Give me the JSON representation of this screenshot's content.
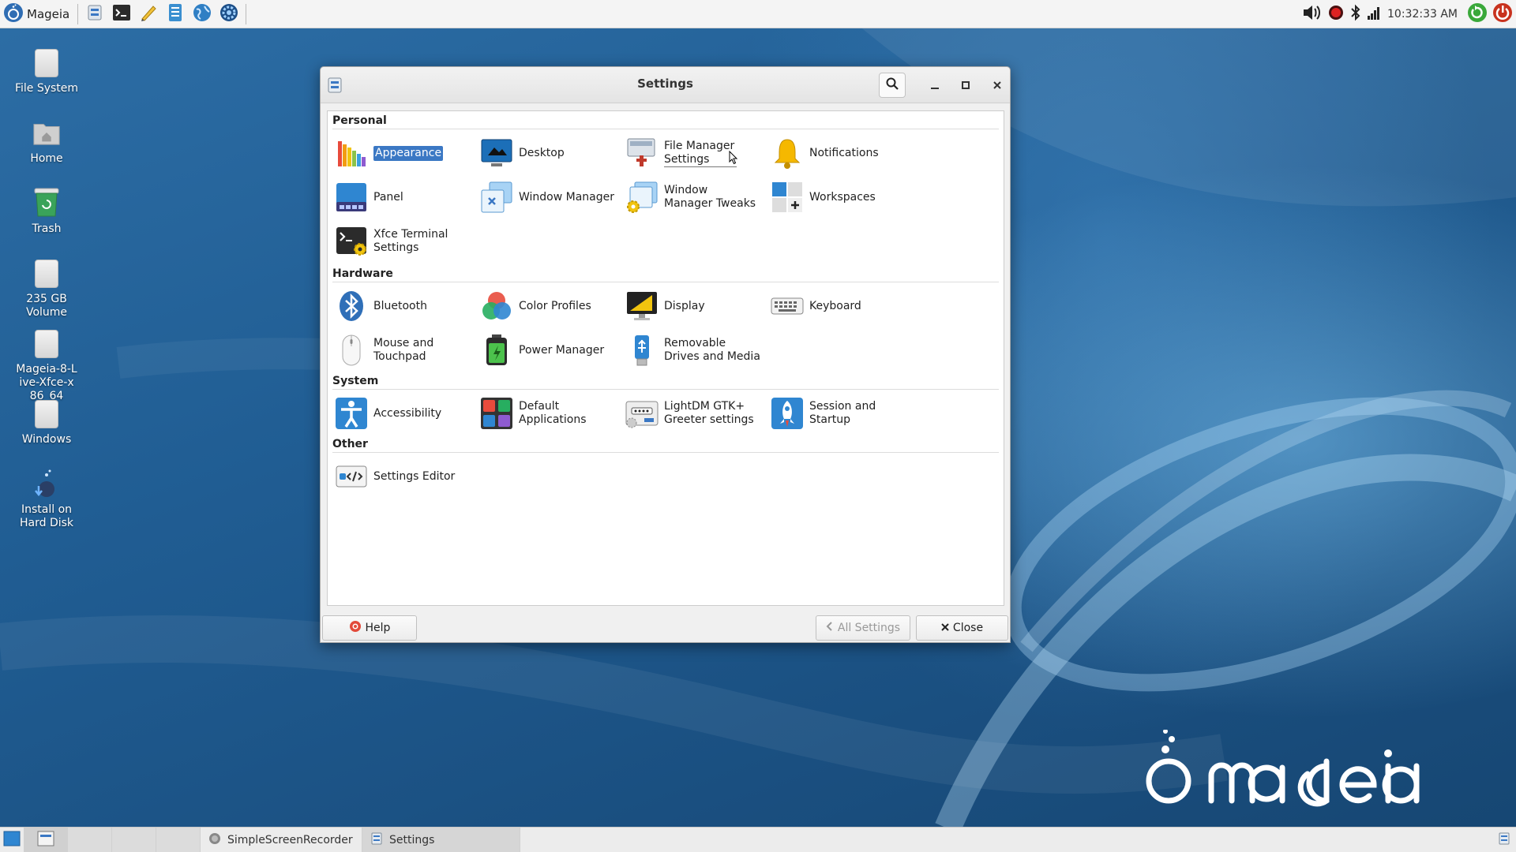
{
  "top_panel": {
    "menu_label": "Mageia",
    "launchers": [
      "settings-launcher",
      "terminal-launcher",
      "text-editor-launcher",
      "file-manager-launcher",
      "web-browser-launcher",
      "system-settings-launcher"
    ],
    "clock": "10:32:33 AM"
  },
  "desktop_icons": [
    {
      "label": "File System"
    },
    {
      "label": "Home"
    },
    {
      "label": "Trash"
    },
    {
      "label": "235 GB Volume"
    },
    {
      "label": "Mageia-8-Live-Xfce-x86_64"
    },
    {
      "label": "Windows"
    },
    {
      "label": "Install on Hard Disk"
    }
  ],
  "window": {
    "title": "Settings",
    "sections": {
      "personal": {
        "title": "Personal",
        "items": [
          "Appearance",
          "Desktop",
          "File Manager Settings",
          "Notifications",
          "Panel",
          "Window Manager",
          "Window Manager Tweaks",
          "Workspaces",
          "Xfce Terminal Settings"
        ]
      },
      "hardware": {
        "title": "Hardware",
        "items": [
          "Bluetooth",
          "Color Profiles",
          "Display",
          "Keyboard",
          "Mouse and Touchpad",
          "Power Manager",
          "Removable Drives and Media"
        ]
      },
      "system": {
        "title": "System",
        "items": [
          "Accessibility",
          "Default Applications",
          "LightDM GTK+ Greeter settings",
          "Session and Startup"
        ]
      },
      "other": {
        "title": "Other",
        "items": [
          "Settings Editor"
        ]
      }
    },
    "buttons": {
      "help": "Help",
      "all_settings": "All Settings",
      "close": "Close"
    }
  },
  "bottom_panel": {
    "tasks": [
      "SimpleScreenRecorder",
      "Settings"
    ]
  },
  "colors": {
    "selection": "#3b78c4",
    "panel": "#f4f4f4",
    "wallpaper": "#205d93"
  }
}
